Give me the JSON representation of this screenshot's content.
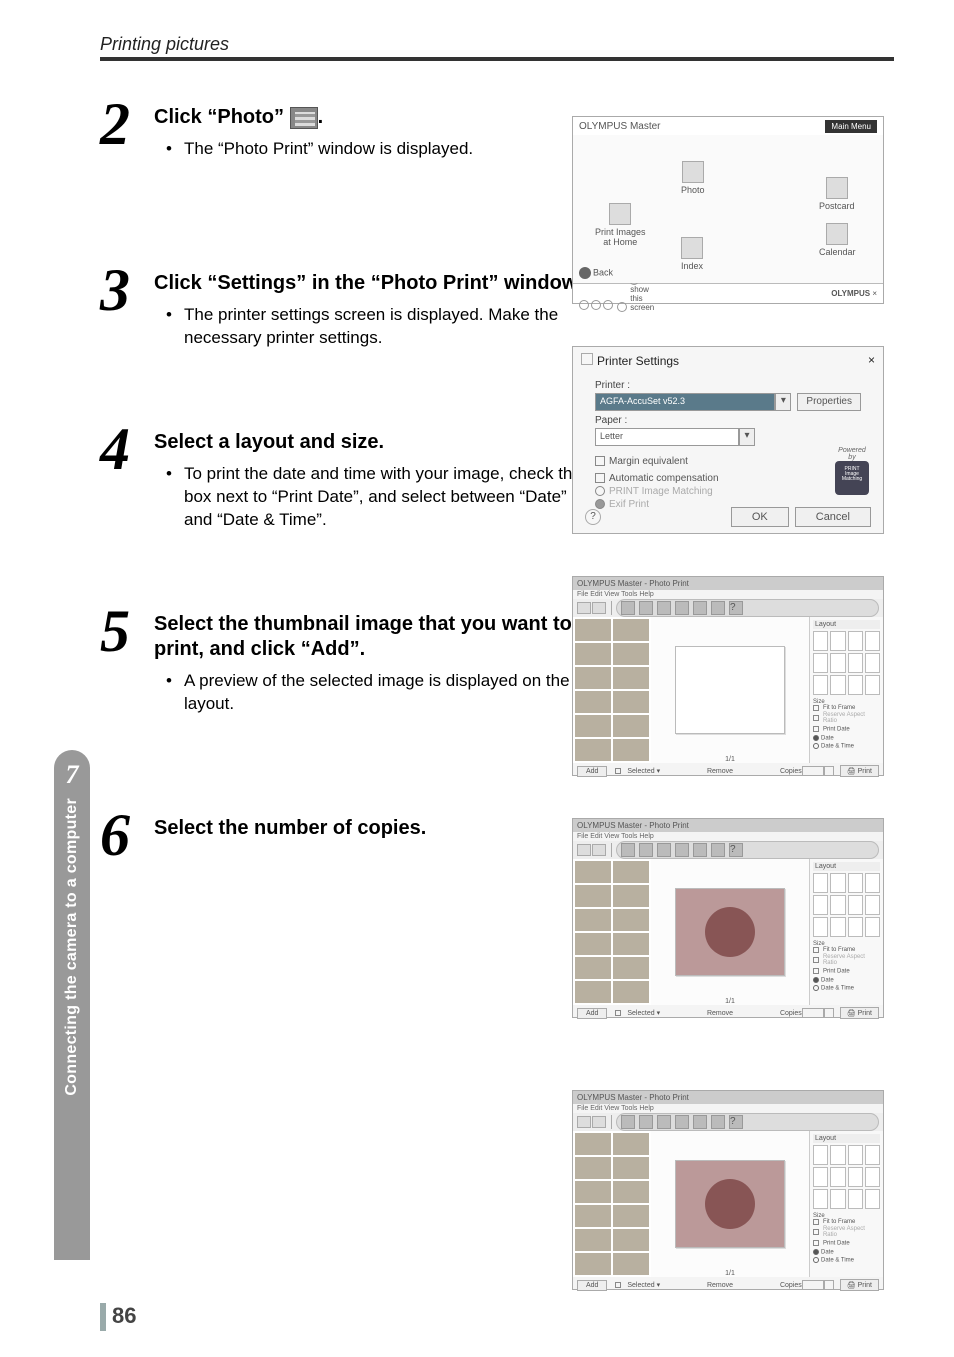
{
  "running_head": "Printing pictures",
  "page_number": "86",
  "side_tab": {
    "number": "7",
    "label": "Connecting the camera to a computer"
  },
  "steps": {
    "s2": {
      "num": "2",
      "heading_pre": "Click “Photo” ",
      "heading_post": ".",
      "bullet1": "The “Photo Print” window is displayed."
    },
    "s3": {
      "num": "3",
      "heading": "Click “Settings” in the “Photo Print” window.",
      "bullet1": "The printer settings screen is displayed. Make the necessary printer settings."
    },
    "s4": {
      "num": "4",
      "heading": "Select a layout and size.",
      "bullet1": "To print the date and time with your image, check the box next to “Print Date”, and select between “Date” and “Date & Time”."
    },
    "s5": {
      "num": "5",
      "heading": "Select the thumbnail image that you want to print, and click “Add”.",
      "bullet1": "A preview of the selected image is displayed on the layout."
    },
    "s6": {
      "num": "6",
      "heading": "Select the number of copies."
    }
  },
  "print_menu": {
    "title_left": "OLYMPUS Master",
    "title_right": "Main Menu",
    "items": {
      "photo": "Photo",
      "postcard": "Postcard",
      "print_images": "Print Images\nat Home",
      "calendar": "Calendar",
      "index": "Index"
    },
    "back": "Back",
    "footer_text": "Don't show this screen",
    "footer_brand": "OLYMPUS"
  },
  "printer_settings": {
    "title": "Printer Settings",
    "close": "×",
    "printer_label": "Printer :",
    "printer_value": "AGFA-AccuSet v52.3",
    "properties_btn": "Properties",
    "paper_label": "Paper :",
    "paper_value": "Letter",
    "margin_chk": "Margin equivalent",
    "auto_chk": "Automatic compensation",
    "pim_radio": "PRINT Image Matching",
    "exif_radio": "Exif Print",
    "powered_by": "Powered by",
    "badge": "PRINT Image Matching",
    "ok": "OK",
    "cancel": "Cancel",
    "help": "?"
  },
  "photo_print": {
    "title": "OLYMPUS Master - Photo Print",
    "menu": "File Edit View Tools Help",
    "layout_label": "Layout",
    "size_label": "Size",
    "fit_to_frame": "Fit to Frame",
    "reserve_aspect": "Reserve Aspect Ratio",
    "print_date_label": "Print Date",
    "date_option": "Date",
    "datetime_option": "Date & Time",
    "add_btn": "Add",
    "remove_btn": "Remove",
    "selected_label": "Selected",
    "copies_label": "Copies",
    "print_btn": "Print",
    "page_indicator": "1/1",
    "help_icon": "?"
  }
}
